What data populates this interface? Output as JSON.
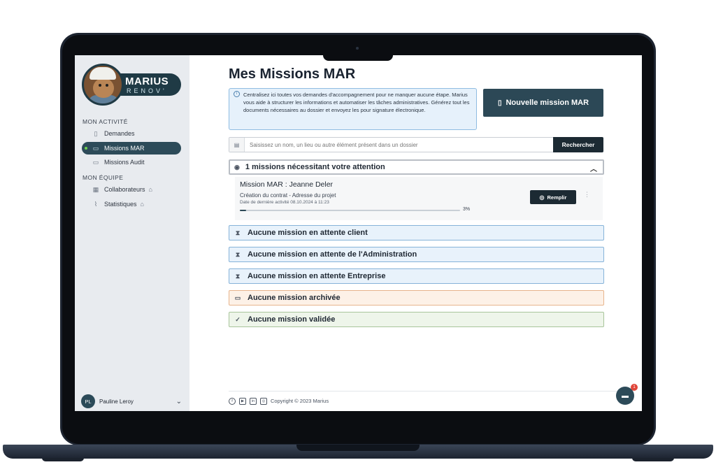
{
  "brand": {
    "name": "MARIUS",
    "sub": "RENOV'"
  },
  "sidebar": {
    "section_activity": "MON ACTIVITÉ",
    "section_team": "MON ÉQUIPE",
    "items": [
      {
        "label": "Demandes",
        "icon": "document-icon"
      },
      {
        "label": "Missions MAR",
        "icon": "folder-icon",
        "active": true
      },
      {
        "label": "Missions Audit",
        "icon": "folder-icon"
      },
      {
        "label": "Collaborateurs",
        "icon": "building-icon",
        "locked": true
      },
      {
        "label": "Statistiques",
        "icon": "chart-icon",
        "locked": true
      }
    ],
    "user": {
      "initials": "PL",
      "name": "Pauline Leroy"
    }
  },
  "main": {
    "title": "Mes Missions MAR",
    "info": "Centralisez ici toutes vos demandes d'accompagnement pour ne manquer aucune étape. Marius vous aide à structurer les informations et automatiser les tâches administratives. Générez tout les documents nécessaires au dossier et envoyez les pour signature électronique.",
    "new_button": "Nouvelle mission MAR",
    "search": {
      "placeholder": "Saisissez un nom, un lieu ou autre élément présent dans un dossier",
      "button": "Rechercher"
    },
    "attention": {
      "title": "1 missions nécessitant votre attention",
      "mission": {
        "title": "Mission MAR : Jeanne Deler",
        "step": "Création du contrat - Adresse du projet",
        "date": "Date de dernière activité 08.10.2024 à 11:23",
        "progress_percent": 3,
        "progress_label": "3%",
        "action": "Remplir"
      }
    },
    "statuses": [
      {
        "label": "Aucune mission en attente client",
        "icon": "hourglass-icon",
        "color": "blue"
      },
      {
        "label": "Aucune mission en attente de l'Administration",
        "icon": "hourglass-icon",
        "color": "blue"
      },
      {
        "label": "Aucune mission en attente Entreprise",
        "icon": "hourglass-icon",
        "color": "blue"
      },
      {
        "label": "Aucune mission archivée",
        "icon": "archive-icon",
        "color": "orange"
      },
      {
        "label": "Aucune mission validée",
        "icon": "thumbs-up-icon",
        "color": "green"
      }
    ]
  },
  "footer": {
    "copyright": "Copyright © 2023 Marius"
  },
  "chat": {
    "badge": "1"
  },
  "colors": {
    "primary": "#2c4856",
    "accent_blue": "#86b3d9",
    "accent_orange": "#e7b48c",
    "accent_green": "#a8c59a"
  }
}
